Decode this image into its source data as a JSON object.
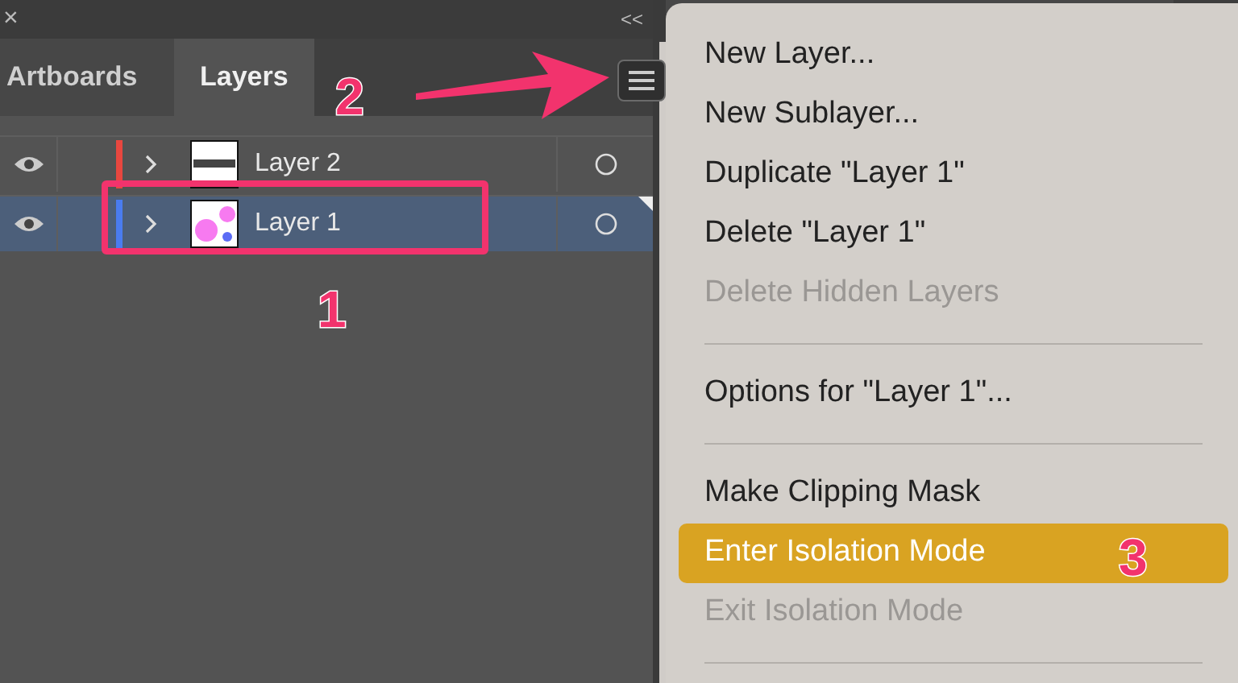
{
  "panel": {
    "close": "×",
    "collapse": "<<",
    "tabs": [
      {
        "label": "Artboards",
        "selected": false
      },
      {
        "label": "Layers",
        "selected": true
      }
    ],
    "layers": [
      {
        "name": "Layer 2",
        "visible": true,
        "color": "#e8473f",
        "selected": false,
        "kind": "text"
      },
      {
        "name": "Layer 1",
        "visible": true,
        "color": "#4a7cf0",
        "selected": true,
        "kind": "bubbles"
      }
    ]
  },
  "menu": {
    "items": [
      {
        "kind": "item",
        "label": "New Layer...",
        "disabled": false,
        "selected": false
      },
      {
        "kind": "item",
        "label": "New Sublayer...",
        "disabled": false,
        "selected": false
      },
      {
        "kind": "item",
        "label": "Duplicate \"Layer 1\"",
        "disabled": false,
        "selected": false
      },
      {
        "kind": "item",
        "label": "Delete \"Layer 1\"",
        "disabled": false,
        "selected": false
      },
      {
        "kind": "item",
        "label": "Delete Hidden Layers",
        "disabled": true,
        "selected": false
      },
      {
        "kind": "separator"
      },
      {
        "kind": "item",
        "label": "Options for \"Layer 1\"...",
        "disabled": false,
        "selected": false
      },
      {
        "kind": "separator"
      },
      {
        "kind": "item",
        "label": "Make Clipping Mask",
        "disabled": false,
        "selected": false
      },
      {
        "kind": "item",
        "label": "Enter Isolation Mode",
        "disabled": false,
        "selected": true
      },
      {
        "kind": "item",
        "label": "Exit Isolation Mode",
        "disabled": true,
        "selected": false
      },
      {
        "kind": "separator"
      }
    ]
  },
  "callouts": [
    {
      "label": "2"
    },
    {
      "label": "1"
    },
    {
      "label": "3"
    }
  ]
}
